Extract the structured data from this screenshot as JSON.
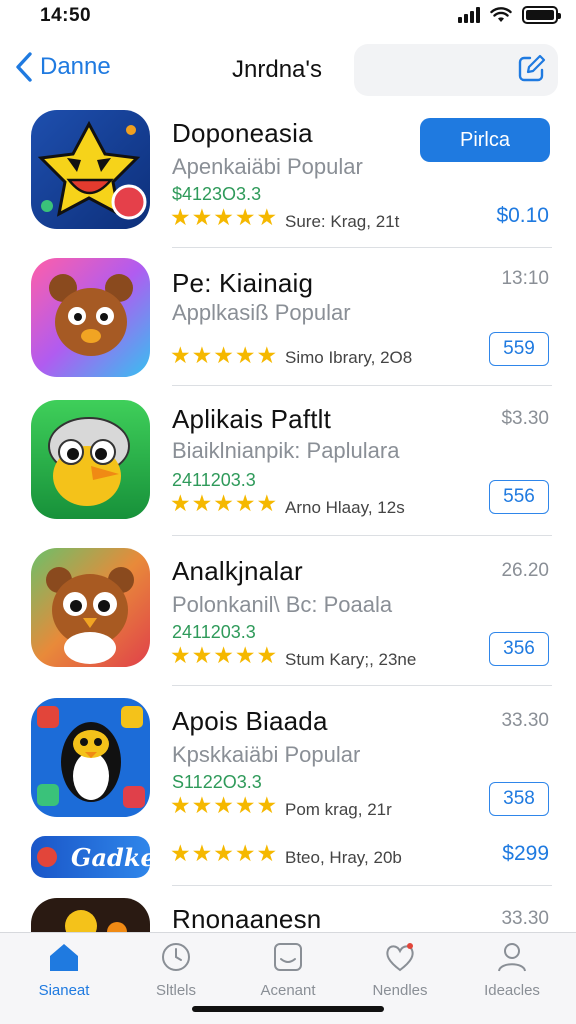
{
  "status": {
    "time": "14:50"
  },
  "nav": {
    "back_label": "Danne",
    "title": "Jnrdna's"
  },
  "apps": [
    {
      "name": "Doponeasia",
      "category": "Apenkaiäbi Popular",
      "code": "$4123O3.3",
      "meta": "Sure: Krag, 21t",
      "side": "",
      "action": "Pirlca",
      "action_type": "primary",
      "price": "$0.10",
      "rating": 5
    },
    {
      "name": "Pe: Kiainaig",
      "category": "Applkasiß Popular",
      "code": "",
      "meta": "Simo Ibrary, 2O8",
      "side": "13:10",
      "action": "",
      "action_type": "none",
      "price": "559",
      "rating": 5
    },
    {
      "name": "Aplikais Paftlt",
      "category": "Biaiklnianpik: Paplulara",
      "code": "2411203.3",
      "meta": "Arno Hlaay, 12s",
      "side": "$3.30",
      "action": "",
      "action_type": "none",
      "price": "556",
      "rating": 5
    },
    {
      "name": "Analkjnalar",
      "category": "Polonkanil\\ Bc: Poaala",
      "code": "2411203.3",
      "meta": "Stum Kary;, 23ne",
      "side": "26.20",
      "action": "",
      "action_type": "none",
      "price": "356",
      "rating": 5
    },
    {
      "name": "Apois Biaada",
      "category": "Kpskkaiäbi Popular",
      "code": "S1122O3.3",
      "meta": "Pom krag, 21r",
      "side": "33.30",
      "action": "",
      "action_type": "none",
      "price": "358",
      "rating": 5
    },
    {
      "name": "",
      "category": "",
      "code": "",
      "meta": "Bteo, Hray, 20b",
      "side": "",
      "action": "",
      "action_type": "none",
      "price": "$299",
      "rating": 5,
      "icon_text": "Gadke"
    },
    {
      "name": "Rnonaanesn",
      "category": "",
      "code": "",
      "meta": "",
      "side": "33.30",
      "action": "",
      "action_type": "none",
      "price": "",
      "rating": 0
    }
  ],
  "tabs": [
    {
      "label": "Sianeat",
      "icon": "house-icon",
      "active": true
    },
    {
      "label": "Sltlels",
      "icon": "compass-icon",
      "active": false
    },
    {
      "label": "Acenant",
      "icon": "tray-icon",
      "active": false
    },
    {
      "label": "Nendles",
      "icon": "heart-icon",
      "active": false
    },
    {
      "label": "Ideacles",
      "icon": "person-icon",
      "active": false
    }
  ],
  "colors": {
    "accent": "#1f7ae0",
    "star": "#f5b800",
    "code_green": "#2f9a5a"
  }
}
